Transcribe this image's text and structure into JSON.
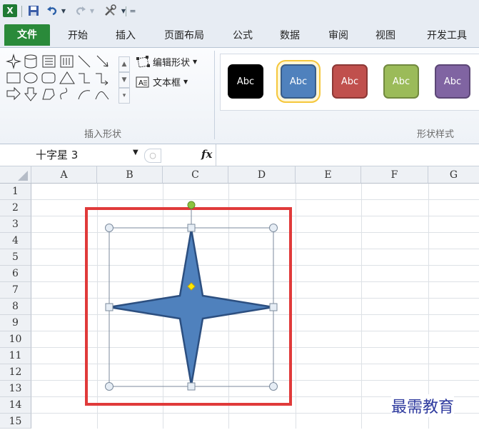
{
  "quick_access": {
    "app_icon": "excel-icon",
    "items": [
      "save-icon",
      "undo-icon",
      "redo-icon",
      "customize-icon"
    ]
  },
  "tabs": [
    "文件",
    "开始",
    "插入",
    "页面布局",
    "公式",
    "数据",
    "审阅",
    "视图",
    "开发工具"
  ],
  "ribbon": {
    "insert_shapes": {
      "label": "插入形状",
      "edit_shape": "编辑形状",
      "text_box": "文本框"
    },
    "shape_styles": {
      "label": "形状样式",
      "swatch_text": "Abc",
      "swatches": [
        {
          "fill": "#000000",
          "border": "#000000"
        },
        {
          "fill": "#4f81bd",
          "border": "#385d8a",
          "selected": true
        },
        {
          "fill": "#c0504d",
          "border": "#8c3836"
        },
        {
          "fill": "#9bbb59",
          "border": "#71893f"
        },
        {
          "fill": "#8064a2",
          "border": "#5c4776"
        }
      ]
    }
  },
  "formula_bar": {
    "name_box": "十字星 3",
    "fx": "fx"
  },
  "columns": [
    "A",
    "B",
    "C",
    "D",
    "E",
    "F",
    "G"
  ],
  "rows": [
    "1",
    "2",
    "3",
    "4",
    "5",
    "6",
    "7",
    "8",
    "9",
    "10",
    "11",
    "12",
    "13",
    "14",
    "15"
  ],
  "shape": {
    "name": "十字星 3",
    "fill": "#4f81bd",
    "outline": "#2c4f80"
  },
  "highlight_color": "#e03a3a",
  "watermark": "最需教育"
}
